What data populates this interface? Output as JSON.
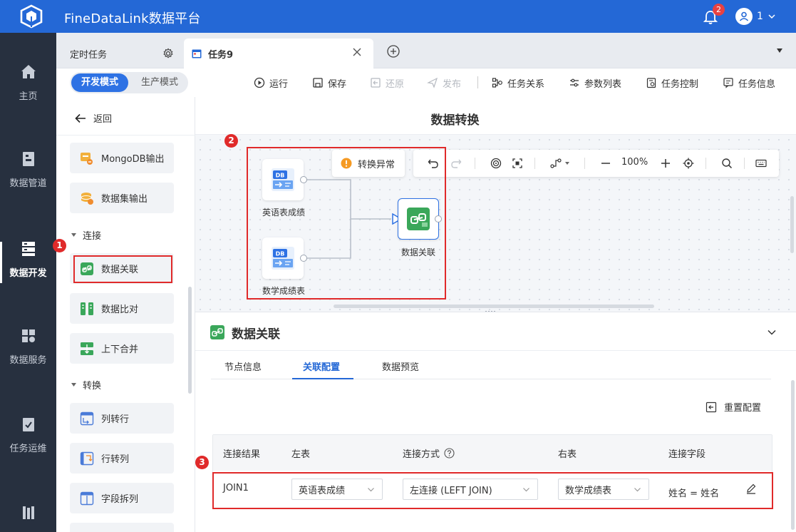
{
  "app": {
    "title": "FineDataLink数据平台",
    "notification_count": "2",
    "user_name": "1"
  },
  "nav": {
    "items": [
      {
        "label": "主页",
        "icon": "home-icon"
      },
      {
        "label": "数据管道",
        "icon": "pipeline-icon"
      },
      {
        "label": "数据开发",
        "icon": "data-dev-icon"
      },
      {
        "label": "数据服务",
        "icon": "data-service-icon"
      },
      {
        "label": "任务运维",
        "icon": "task-ops-icon"
      },
      {
        "label": "",
        "icon": "more-icon"
      }
    ],
    "active": "数据开发"
  },
  "tabs": {
    "fixed": "定时任务",
    "active": "任务9"
  },
  "toolbar": {
    "mode_dev": "开发模式",
    "mode_prod": "生产模式",
    "run": "运行",
    "save": "保存",
    "restore": "还原",
    "publish": "发布",
    "task_relation": "任务关系",
    "param_list": "参数列表",
    "task_control": "任务控制",
    "task_info": "任务信息"
  },
  "panel": {
    "back": "返回",
    "items_top": [
      "MongoDB输出",
      "数据集输出"
    ],
    "group_join": "连接",
    "items_join": [
      "数据关联",
      "数据比对",
      "上下合并"
    ],
    "group_transform": "转换",
    "items_transform": [
      "列转行",
      "行转列",
      "字段拆列"
    ]
  },
  "page_title": "数据转换",
  "canvas": {
    "warning": "转换异常",
    "zoom": "100%",
    "nodes": [
      "英语表成绩",
      "数学成绩表",
      "数据关联"
    ],
    "db_label": "DB"
  },
  "config": {
    "title": "数据关联",
    "tabs": [
      "节点信息",
      "关联配置",
      "数据预览"
    ],
    "active_tab": "关联配置",
    "reset": "重置配置",
    "columns": [
      "连接结果",
      "左表",
      "连接方式",
      "右表",
      "连接字段"
    ],
    "row": {
      "result": "JOIN1",
      "left_table": "英语表成绩",
      "join_type": "左连接 (LEFT JOIN)",
      "right_table": "数学成绩表",
      "join_field": "姓名 = 姓名"
    }
  },
  "annotations": [
    "1",
    "2",
    "3"
  ],
  "colors": {
    "primary": "#2468d6",
    "nav_bg": "#27303f",
    "highlight": "#e02a2a",
    "success": "#3aa75a"
  }
}
